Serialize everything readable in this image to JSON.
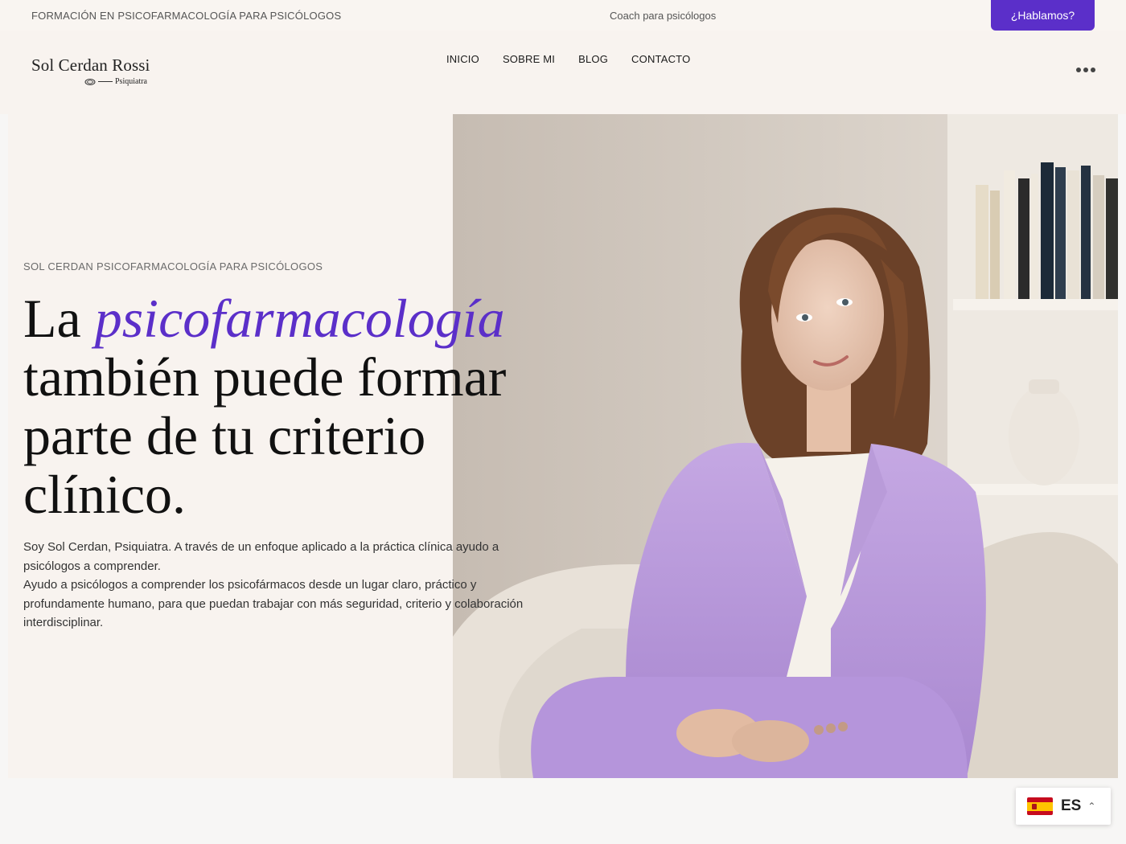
{
  "topbar": {
    "tagline": "FORMACIÓN EN PSICOFARMACOLOGÍA PARA PSICÓLOGOS",
    "coach": "Coach para psicólogos",
    "cta": "¿Hablamos?"
  },
  "header": {
    "logo_name": "Sol Cerdan Rossi",
    "logo_sub": "Psiquiatra",
    "nav": [
      "INICIO",
      "SOBRE MI",
      "BLOG",
      "CONTACTO"
    ],
    "more_icon": "more-dots-icon"
  },
  "hero": {
    "kicker": "SOL CERDAN PSICOFARMACOLOGÍA PARA PSICÓLOGOS",
    "headline_lead": "La ",
    "headline_accent": "psicofarmacología",
    "headline_rest": "también puede formar parte de tu criterio clínico.",
    "intro_1": "Soy Sol Cerdan, Psiquiatra. A través de un enfoque aplicado a la práctica clínica ayudo a psicólogos a comprender.",
    "intro_2": "Ayudo a psicólogos a comprender los psicofármacos desde un lugar claro, práctico y profundamente humano, para que puedan trabajar con más seguridad, criterio y colaboración interdisciplinar.",
    "accent_color": "#5b2fc9"
  },
  "language": {
    "code": "ES",
    "flag": "spain-flag-icon",
    "chevron": "chevron-up-icon"
  }
}
